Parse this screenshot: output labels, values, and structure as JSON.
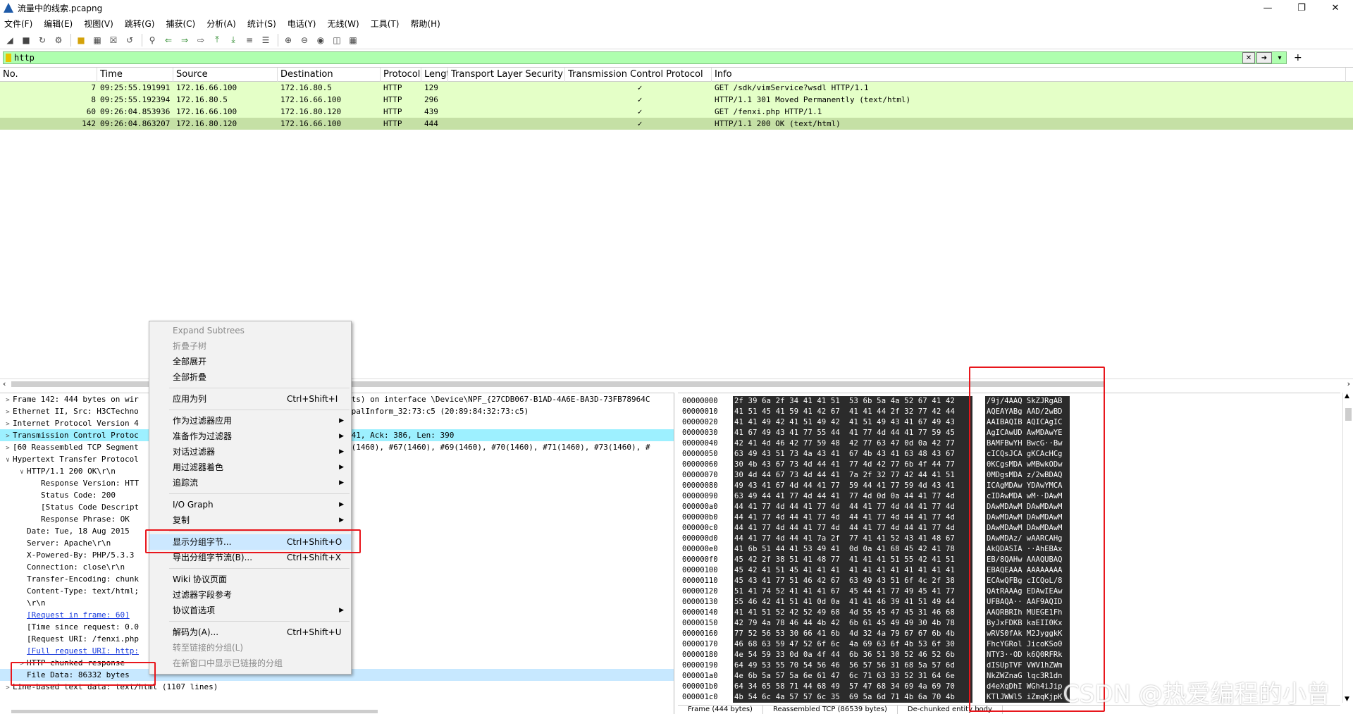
{
  "window": {
    "title": "流量中的线索.pcapng",
    "min_icon": "minimize-icon",
    "max_icon": "maximize-icon",
    "close_icon": "close-icon"
  },
  "menu": [
    "文件(F)",
    "编辑(E)",
    "视图(V)",
    "跳转(G)",
    "捕获(C)",
    "分析(A)",
    "统计(S)",
    "电话(Y)",
    "无线(W)",
    "工具(T)",
    "帮助(H)"
  ],
  "filter": {
    "value": "http"
  },
  "packet_list": {
    "columns": [
      "No.",
      "Time",
      "Source",
      "Destination",
      "Protocol",
      "Lengt",
      "Transport Layer Security",
      "Transmission Control Protocol",
      "Info"
    ],
    "rows": [
      {
        "no": "7",
        "time": "09:25:55.191991",
        "src": "172.16.66.100",
        "dst": "172.16.80.5",
        "proto": "HTTP",
        "len": "129",
        "tls": "",
        "tcp": "✓",
        "info": "GET /sdk/vimService?wsdl HTTP/1.1"
      },
      {
        "no": "8",
        "time": "09:25:55.192394",
        "src": "172.16.80.5",
        "dst": "172.16.66.100",
        "proto": "HTTP",
        "len": "296",
        "tls": "",
        "tcp": "✓",
        "info": "HTTP/1.1 301 Moved Permanently  (text/html)"
      },
      {
        "no": "60",
        "time": "09:26:04.853936",
        "src": "172.16.66.100",
        "dst": "172.16.80.120",
        "proto": "HTTP",
        "len": "439",
        "tls": "",
        "tcp": "✓",
        "info": "GET /fenxi.php HTTP/1.1"
      },
      {
        "no": "142",
        "time": "09:26:04.863207",
        "src": "172.16.80.120",
        "dst": "172.16.66.100",
        "proto": "HTTP",
        "len": "444",
        "tls": "",
        "tcp": "✓",
        "info": "HTTP/1.1 200 OK  (text/html)"
      }
    ]
  },
  "details": [
    {
      "t": "Frame 142: 444 bytes on wir",
      "r": "its) on interface \\Device\\NPF_{27CDB067-B1AD-4A6E-BA3D-73FB78964C"
    },
    {
      "t": "Ethernet II, Src: H3CTechno",
      "r": "mpalInform_32:73:c5 (20:89:84:32:73:c5)"
    },
    {
      "t": "Internet Protocol Version 4",
      "r": ""
    },
    {
      "t": "Transmission Control Protoc",
      "r": "141, Ack: 386, Len: 390"
    },
    {
      "t": "[60 Reassembled TCP Segment",
      "r": "6(1460), #67(1460), #69(1460), #70(1460), #71(1460), #73(1460), #"
    },
    {
      "t": "Hypertext Transfer Protocol",
      "r": ""
    },
    {
      "t": "HTTP/1.1 200 OK\\r\\n",
      "r": ""
    },
    {
      "t": "Response Version: HTT",
      "r": ""
    },
    {
      "t": "Status Code: 200",
      "r": ""
    },
    {
      "t": "[Status Code Descript",
      "r": ""
    },
    {
      "t": "Response Phrase: OK",
      "r": ""
    },
    {
      "t": "Date: Tue, 18 Aug 2015",
      "r": ""
    },
    {
      "t": "Server: Apache\\r\\n",
      "r": ""
    },
    {
      "t": "X-Powered-By: PHP/5.3.3",
      "r": ""
    },
    {
      "t": "Connection: close\\r\\n",
      "r": ""
    },
    {
      "t": "Transfer-Encoding: chunk",
      "r": ""
    },
    {
      "t": "Content-Type: text/html;",
      "r": ""
    },
    {
      "t": "\\r\\n",
      "r": ""
    },
    {
      "t": "[Request in frame: 60]",
      "r": ""
    },
    {
      "t": "[Time since request: 0.0",
      "r": ""
    },
    {
      "t": "[Request URI: /fenxi.php",
      "r": ""
    },
    {
      "t": "[Full request URI: http:",
      "r": ""
    },
    {
      "t": "HTTP chunked response",
      "r": ""
    },
    {
      "t": "File Data: 86332 bytes",
      "r": ""
    },
    {
      "t": "Line-based text data: text/html (1107 lines)",
      "r": ""
    }
  ],
  "bytes": [
    {
      "o": "00000000",
      "h": "2f 39 6a 2f 34 41 41 51  53 6b 5a 4a 52 67 41 42",
      "a": "/9j/4AAQ SkZJRgAB"
    },
    {
      "o": "00000010",
      "h": "41 51 45 41 59 41 42 67  41 41 44 2f 32 77 42 44",
      "a": "AQEAYABg AAD/2wBD"
    },
    {
      "o": "00000020",
      "h": "41 41 49 42 41 51 49 42  41 51 49 43 41 67 49 43",
      "a": "AAIBAQIB AQICAgIC"
    },
    {
      "o": "00000030",
      "h": "41 67 49 43 41 77 55 44  41 77 4d 44 41 77 59 45",
      "a": "AgICAwUD AwMDAwYE"
    },
    {
      "o": "00000040",
      "h": "42 41 4d 46 42 77 59 48  42 77 63 47 0d 0a 42 77",
      "a": "BAMFBwYH BwcG··Bw"
    },
    {
      "o": "00000050",
      "h": "63 49 43 51 73 4a 43 41  67 4b 43 41 63 48 43 67",
      "a": "cICQsJCA gKCAcHCg"
    },
    {
      "o": "00000060",
      "h": "30 4b 43 67 73 4d 44 41  77 4d 42 77 6b 4f 44 77",
      "a": "0KCgsMDA wMBwkODw"
    },
    {
      "o": "00000070",
      "h": "30 4d 44 67 73 4d 44 41  7a 2f 32 77 42 44 41 51",
      "a": "0MDgsMDA z/2wBDAQ"
    },
    {
      "o": "00000080",
      "h": "49 43 41 67 4d 44 41 77  59 44 41 77 59 4d 43 41",
      "a": "ICAgMDAw YDAwYMCA"
    },
    {
      "o": "00000090",
      "h": "63 49 44 41 77 4d 44 41  77 4d 0d 0a 44 41 77 4d",
      "a": "cIDAwMDA wM··DAwM"
    },
    {
      "o": "000000a0",
      "h": "44 41 77 4d 44 41 77 4d  44 41 77 4d 44 41 77 4d",
      "a": "DAwMDAwM DAwMDAwM"
    },
    {
      "o": "000000b0",
      "h": "44 41 77 4d 44 41 77 4d  44 41 77 4d 44 41 77 4d",
      "a": "DAwMDAwM DAwMDAwM"
    },
    {
      "o": "000000c0",
      "h": "44 41 77 4d 44 41 77 4d  44 41 77 4d 44 41 77 4d",
      "a": "DAwMDAwM DAwMDAwM"
    },
    {
      "o": "000000d0",
      "h": "44 41 77 4d 44 41 7a 2f  77 41 41 52 43 41 48 67",
      "a": "DAwMDAz/ wAARCAHg"
    },
    {
      "o": "000000e0",
      "h": "41 6b 51 44 41 53 49 41  0d 0a 41 68 45 42 41 78",
      "a": "AkQDASIA ··AhEBAx"
    },
    {
      "o": "000000f0",
      "h": "45 42 2f 38 51 41 48 77  41 41 41 51 55 42 41 51",
      "a": "EB/8QAHw AAAQUBAQ"
    },
    {
      "o": "00000100",
      "h": "45 42 41 51 45 41 41 41  41 41 41 41 41 41 41 41",
      "a": "EBAQEAAA AAAAAAAA"
    },
    {
      "o": "00000110",
      "h": "45 43 41 77 51 46 42 67  63 49 43 51 6f 4c 2f 38",
      "a": "ECAwQFBg cICQoL/8"
    },
    {
      "o": "00000120",
      "h": "51 41 74 52 41 41 41 67  45 44 41 77 49 45 41 77",
      "a": "QAtRAAAg EDAwIEAw"
    },
    {
      "o": "00000130",
      "h": "55 46 42 41 51 41 0d 0a  41 41 46 39 41 51 49 44",
      "a": "UFBAQA·· AAF9AQID"
    },
    {
      "o": "00000140",
      "h": "41 41 51 52 42 52 49 68  4d 55 45 47 45 31 46 68",
      "a": "AAQRBRIh MUEGE1Fh"
    },
    {
      "o": "00000150",
      "h": "42 79 4a 78 46 44 4b 42  6b 61 45 49 49 30 4b 78",
      "a": "ByJxFDKB kaEII0Kx"
    },
    {
      "o": "00000160",
      "h": "77 52 56 53 30 66 41 6b  4d 32 4a 79 67 67 6b 4b",
      "a": "wRVS0fAk M2JyggkK"
    },
    {
      "o": "00000170",
      "h": "46 68 63 59 47 52 6f 6c  4a 69 63 6f 4b 53 6f 30",
      "a": "FhcYGRol JicoKSo0"
    },
    {
      "o": "00000180",
      "h": "4e 54 59 33 0d 0a 4f 44  6b 36 51 30 52 46 52 6b",
      "a": "NTY3··OD k6Q0RFRk"
    },
    {
      "o": "00000190",
      "h": "64 49 53 55 70 54 56 46  56 57 56 31 68 5a 57 6d",
      "a": "dISUpTVF VWV1hZWm"
    },
    {
      "o": "000001a0",
      "h": "4e 6b 5a 57 5a 6e 61 47  6c 71 63 33 52 31 64 6e",
      "a": "NkZWZnaG lqc3R1dn"
    },
    {
      "o": "000001b0",
      "h": "64 34 65 58 71 44 68 49  57 47 68 34 69 4a 69 70",
      "a": "d4eXqDhI WGh4iJip"
    },
    {
      "o": "000001c0",
      "h": "4b 54 6c 4a 57 57 6c 35  69 5a 6d 71 4b 6a 70 4b",
      "a": "KTlJWWl5 iZmqKjpK"
    }
  ],
  "context_menu": [
    {
      "label": "Expand Subtrees",
      "disabled": true
    },
    {
      "label": "折叠子树",
      "disabled": true
    },
    {
      "label": "全部展开"
    },
    {
      "label": "全部折叠"
    },
    {
      "sep": true
    },
    {
      "label": "应用为列",
      "shortcut": "Ctrl+Shift+I"
    },
    {
      "sep": true
    },
    {
      "label": "作为过滤器应用",
      "sub": true
    },
    {
      "label": "准备作为过滤器",
      "sub": true
    },
    {
      "label": "对话过滤器",
      "sub": true
    },
    {
      "label": "用过滤器着色",
      "sub": true
    },
    {
      "label": "追踪流",
      "sub": true
    },
    {
      "sep": true
    },
    {
      "label": "I/O Graph",
      "sub": true
    },
    {
      "label": "复制",
      "sub": true
    },
    {
      "sep": true
    },
    {
      "label": "显示分组字节...",
      "shortcut": "Ctrl+Shift+O",
      "active": true
    },
    {
      "label": "导出分组字节流(B)...",
      "shortcut": "Ctrl+Shift+X"
    },
    {
      "sep": true
    },
    {
      "label": "Wiki 协议页面"
    },
    {
      "label": "过滤器字段参考"
    },
    {
      "label": "协议首选项",
      "sub": true
    },
    {
      "sep": true
    },
    {
      "label": "解码为(A)...",
      "shortcut": "Ctrl+Shift+U"
    },
    {
      "label": "转至链接的分组(L)",
      "disabled": true
    },
    {
      "label": "在新窗口中显示已链接的分组",
      "disabled": true
    }
  ],
  "bottom_tabs": [
    "Frame (444 bytes)",
    "Reassembled TCP (86539 bytes)",
    "De-chunked entity body"
  ],
  "watermark": "CSDN @热爱编程的小曾"
}
